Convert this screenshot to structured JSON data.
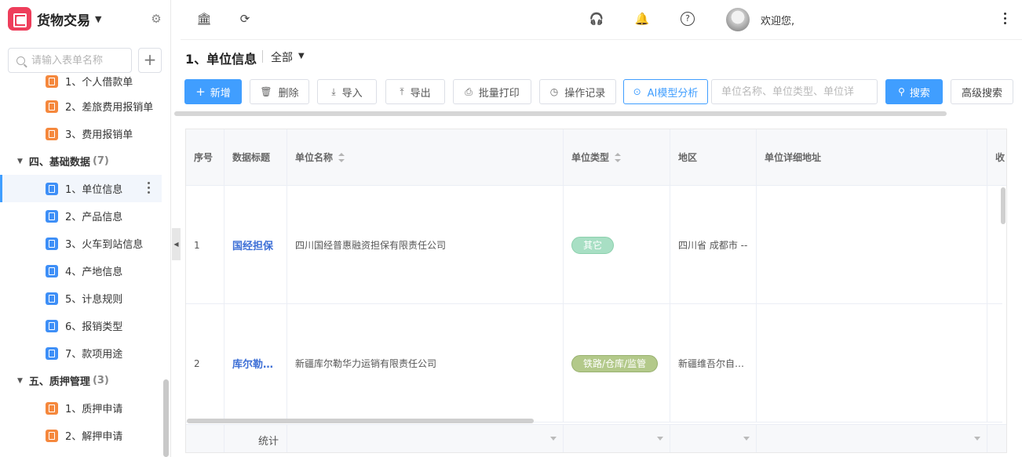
{
  "brand": {
    "title": "货物交易"
  },
  "sidebar": {
    "search_placeholder": "请输入表单名称",
    "partial_item": "1、个人借款单",
    "items": [
      {
        "label": "2、差旅费用报销单",
        "color": "orange"
      },
      {
        "label": "3、费用报销单",
        "color": "orange"
      }
    ],
    "group_basic": {
      "label": "四、基础数据",
      "count": "(7)"
    },
    "basic_items": [
      {
        "label": "1、单位信息",
        "active": true
      },
      {
        "label": "2、产品信息"
      },
      {
        "label": "3、火车到站信息"
      },
      {
        "label": "4、产地信息"
      },
      {
        "label": "5、计息规则"
      },
      {
        "label": "6、报销类型"
      },
      {
        "label": "7、款项用途"
      }
    ],
    "group_pledge": {
      "label": "五、质押管理",
      "count": "(3)"
    },
    "pledge_items": [
      {
        "label": "1、质押申请"
      },
      {
        "label": "2、解押申请"
      }
    ]
  },
  "header": {
    "welcome": "欢迎您,"
  },
  "page": {
    "title": "1、单位信息",
    "filter": "全部"
  },
  "toolbar": {
    "add": "新增",
    "delete": "删除",
    "import": "导入",
    "export": "导出",
    "batch_print": "批量打印",
    "op_log": "操作记录",
    "ai": "AI模型分析",
    "search_placeholder": "单位名称、单位类型、单位详",
    "search": "搜索",
    "advanced": "高级搜索"
  },
  "table": {
    "columns": [
      "序号",
      "数据标题",
      "单位名称",
      "单位类型",
      "地区",
      "单位详细地址",
      "收"
    ],
    "rows": [
      {
        "index": "1",
        "title": "国经担保",
        "name": "四川国经普惠融资担保有限责任公司",
        "type": "其它",
        "region": "四川省 成都市 --",
        "address": ""
      },
      {
        "index": "2",
        "title": "库尔勒…",
        "name": "新疆库尔勒华力运销有限责任公司",
        "type": "铁路/仓库/监管",
        "region": "新疆维吾尔自…",
        "address": ""
      }
    ],
    "footer_label": "统计"
  },
  "colors": {
    "accent": "#409eff",
    "brand": "#ee3e5b",
    "link": "#3d6fd6"
  }
}
